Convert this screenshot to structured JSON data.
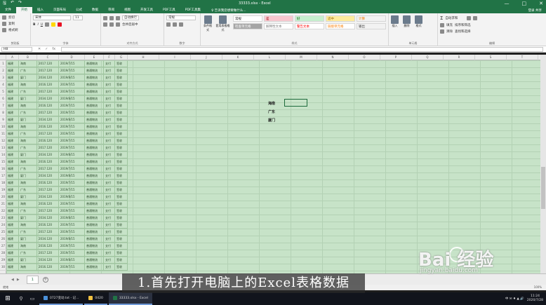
{
  "titlebar": {
    "title": "33333.xlsx - Excel",
    "minimize": "—",
    "maximize": "□",
    "close": "✕"
  },
  "ribbon_tabs": [
    "文件",
    "开始",
    "插入",
    "页面布局",
    "公式",
    "数据",
    "审阅",
    "视图",
    "开发工具",
    "PDF工具",
    "PDF工具集"
  ],
  "active_tab": "开始",
  "tell_me": "♀ 告诉我您想要做什么...",
  "user": "登录  共享",
  "ribbon": {
    "clipboard": {
      "cut": "剪切",
      "copy": "复制",
      "format_painter": "格式刷",
      "label": "剪贴板"
    },
    "font": {
      "name": "宋体",
      "size": "11",
      "label": "字体"
    },
    "alignment": {
      "wrap": "自动换行",
      "merge": "合并后居中",
      "label": "对齐方式"
    },
    "number": {
      "format": "常规",
      "label": "数字"
    },
    "styles": {
      "conditional": "条件格式",
      "table": "套用表格格式",
      "label": "样式",
      "cells": [
        {
          "text": "常规",
          "bg": "#ffffff",
          "fg": "#222222"
        },
        {
          "text": "差",
          "bg": "#f7c7ce",
          "fg": "#9c0006"
        },
        {
          "text": "好",
          "bg": "#c6efce",
          "fg": "#006100"
        },
        {
          "text": "适中",
          "bg": "#ffeb9c",
          "fg": "#9c6500"
        },
        {
          "text": "计算",
          "bg": "#f2f2f2",
          "fg": "#fa7d00"
        },
        {
          "text": "检查单元格",
          "bg": "#a5a5a5",
          "fg": "#ffffff"
        },
        {
          "text": "解释性文本",
          "bg": "#ffffff",
          "fg": "#7f7f7f"
        },
        {
          "text": "警告文本",
          "bg": "#ffffff",
          "fg": "#ff0000"
        },
        {
          "text": "链接单元格",
          "bg": "#ffffff",
          "fg": "#fa7d00"
        },
        {
          "text": "输出",
          "bg": "#f2f2f2",
          "fg": "#3f3f3f"
        }
      ]
    },
    "cells": {
      "insert": "插入",
      "delete": "删除",
      "format": "格式",
      "label": "单元格"
    },
    "editing": {
      "autosum": "自动求和",
      "fill": "填充",
      "clear": "清除",
      "sort": "排序和筛选",
      "find": "查找和选择",
      "label": "编辑"
    }
  },
  "formula_bar": {
    "name_box": "H8",
    "fx": "fx"
  },
  "columns": [
    "A",
    "B",
    "C",
    "D",
    "E",
    "F",
    "G",
    "H",
    "I",
    "J",
    "K",
    "L",
    "M",
    "N",
    "O",
    "P",
    "Q",
    "R",
    "S",
    "T"
  ],
  "rows": [
    [
      "福建",
      "海南",
      "2017.120",
      "2019/7/15",
      "普通物流",
      "支付",
      "签收"
    ],
    [
      "福建",
      "广东",
      "2017.120",
      "2019/7/15",
      "普通物流",
      "支付",
      "签收"
    ],
    [
      "福建",
      "厦门",
      "2034.120",
      "2019/8/15",
      "普通物流",
      "支付",
      "签收"
    ],
    [
      "福建",
      "海南",
      "2016.120",
      "2019/7/15",
      "普通物流",
      "支付",
      "签收"
    ],
    [
      "福建",
      "广东",
      "2017.120",
      "2019/7/15",
      "普通物流",
      "支付",
      "签收"
    ],
    [
      "福建",
      "厦门",
      "2034.120",
      "2019/8/15",
      "普通物流",
      "支付",
      "签收"
    ],
    [
      "福建",
      "海南",
      "2016.120",
      "2019/7/15",
      "普通物流",
      "支付",
      "签收"
    ],
    [
      "福建",
      "广东",
      "2017.120",
      "2019/7/15",
      "普通物流",
      "支付",
      "签收"
    ],
    [
      "福建",
      "厦门",
      "2034.120",
      "2019/8/15",
      "普通物流",
      "支付",
      "签收"
    ],
    [
      "福建",
      "海南",
      "2016.120",
      "2019/7/15",
      "普通物流",
      "支付",
      "签收"
    ],
    [
      "福建",
      "广东",
      "2017.120",
      "2019/7/15",
      "普通物流",
      "支付",
      "签收"
    ],
    [
      "福建",
      "海南",
      "2016.120",
      "2019/7/15",
      "普通物流",
      "支付",
      "签收"
    ],
    [
      "福建",
      "广东",
      "2017.120",
      "2019/7/15",
      "普通物流",
      "支付",
      "签收"
    ],
    [
      "福建",
      "厦门",
      "2034.120",
      "2019/8/15",
      "普通物流",
      "支付",
      "签收"
    ],
    [
      "福建",
      "海南",
      "2016.120",
      "2019/7/15",
      "普通物流",
      "支付",
      "签收"
    ],
    [
      "福建",
      "广东",
      "2017.120",
      "2019/7/15",
      "普通物流",
      "支付",
      "签收"
    ],
    [
      "福建",
      "厦门",
      "2034.120",
      "2019/8/15",
      "普通物流",
      "支付",
      "签收"
    ],
    [
      "福建",
      "海南",
      "2016.120",
      "2019/7/15",
      "普通物流",
      "支付",
      "签收"
    ],
    [
      "福建",
      "广东",
      "2017.120",
      "2019/7/15",
      "普通物流",
      "支付",
      "签收"
    ],
    [
      "福建",
      "厦门",
      "2034.120",
      "2019/8/15",
      "普通物流",
      "支付",
      "签收"
    ],
    [
      "福建",
      "海南",
      "2016.120",
      "2019/7/15",
      "普通物流",
      "支付",
      "签收"
    ],
    [
      "福建",
      "广东",
      "2017.120",
      "2019/7/15",
      "普通物流",
      "支付",
      "签收"
    ],
    [
      "福建",
      "厦门",
      "2034.120",
      "2019/8/15",
      "普通物流",
      "支付",
      "签收"
    ],
    [
      "福建",
      "海南",
      "2016.120",
      "2019/7/15",
      "普通物流",
      "支付",
      "签收"
    ],
    [
      "福建",
      "广东",
      "2017.120",
      "2019/7/15",
      "普通物流",
      "支付",
      "签收"
    ],
    [
      "福建",
      "厦门",
      "2034.120",
      "2019/8/15",
      "普通物流",
      "支付",
      "签收"
    ],
    [
      "福建",
      "海南",
      "2016.120",
      "2019/7/15",
      "普通物流",
      "支付",
      "签收"
    ],
    [
      "福建",
      "广东",
      "2017.120",
      "2019/7/15",
      "普通物流",
      "支付",
      "签收"
    ],
    [
      "福建",
      "厦门",
      "2034.120",
      "2019/8/15",
      "普通物流",
      "支付",
      "签收"
    ],
    [
      "福建",
      "海南",
      "2016.120",
      "2019/7/15",
      "普通物流",
      "支付",
      "签收"
    ]
  ],
  "side_labels": [
    "海南",
    "广东",
    "厦门"
  ],
  "sheet_tab": "1",
  "status": {
    "ready": "就绪",
    "zoom": "100%"
  },
  "taskbar": {
    "apps": [
      {
        "label": "0727变动.txt - 记..."
      },
      {
        "label": "0420"
      },
      {
        "label": "33333.xlsx - Excel"
      }
    ],
    "time": "11:24",
    "date": "2020/7/28",
    "tray": "中 ✉ ♦ ▲ 🔊"
  },
  "caption": "1.首先打开电脑上的Excel表格数据",
  "watermark": {
    "main": "Bai 经验",
    "sub": "jingyan.baidu.com"
  },
  "colors": {
    "excel_green": "#217346",
    "grid_bg": "#c7e3c8"
  }
}
